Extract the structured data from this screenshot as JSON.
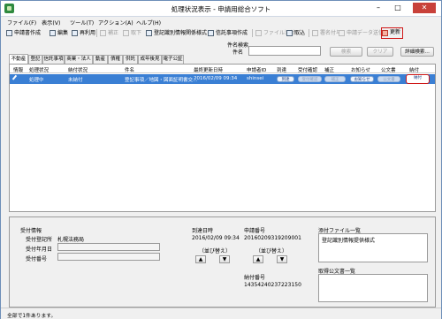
{
  "window": {
    "title": "処理状況表示 - 申請用総合ソフト",
    "controls": {
      "minimize": "–",
      "maximize": "□",
      "close": "✕"
    }
  },
  "menu": [
    "ファイル(F)",
    "表示(V)",
    "ツール(T)",
    "アクション(A)",
    "ヘルプ(H)"
  ],
  "toolbar": {
    "items": [
      {
        "label": "申請書作成",
        "icon": "new-document-icon",
        "enabled": true
      },
      {
        "label": "編集",
        "icon": "edit-icon",
        "enabled": true
      },
      {
        "label": "再利用",
        "icon": "reuse-icon",
        "enabled": true
      },
      {
        "label": "補正",
        "icon": "amend-icon",
        "enabled": false
      },
      {
        "label": "取下",
        "icon": "withdraw-icon",
        "enabled": false
      },
      {
        "label": "登記識別情報関係様式",
        "icon": "form-icon",
        "enabled": true
      },
      {
        "label": "信託事項作成",
        "icon": "trust-icon",
        "enabled": true
      },
      {
        "label": "ファイル添付",
        "icon": "attach-icon",
        "enabled": false
      },
      {
        "label": "取込",
        "icon": "import-icon",
        "enabled": true
      },
      {
        "label": "署名付与",
        "icon": "sign-icon",
        "enabled": false
      },
      {
        "label": "申請データ送信",
        "icon": "send-icon",
        "enabled": false
      },
      {
        "label": "更新",
        "icon": "refresh-icon",
        "enabled": true
      }
    ]
  },
  "search": {
    "group_label": "件名検索",
    "field_label": "件名",
    "value": "",
    "search_button": "検索",
    "clear_button": "クリア",
    "detail_button": "詳細検索..."
  },
  "tabs": [
    "不動産",
    "登記",
    "信託事項",
    "商業・法人",
    "動産",
    "債権",
    "供託",
    "成年後見",
    "電子公証"
  ],
  "grid": {
    "columns": [
      "情報",
      "処理状況",
      "納付状況",
      "件名",
      "最終更新日時",
      "申請者ID",
      "到達",
      "受付確認",
      "補正",
      "お知らせ",
      "公文書",
      "納付"
    ],
    "rows": [
      {
        "status": "処理中",
        "payment_status": "未納付",
        "subject": "登記事項／地図・図面証明書交...",
        "updated": "2016/02/09 09:34",
        "applicant_id": "shinsei",
        "actions": {
          "arrival": "到達",
          "receipt": "受付確認",
          "amend": "補正",
          "notice": "お知らせ",
          "official": "公文書",
          "payment": "納付"
        }
      }
    ]
  },
  "details": {
    "receipt_info_label": "受付情報",
    "receipt_office_label": "受付登記所",
    "receipt_office_value": "札幌法務局",
    "receipt_date_label": "受付年月日",
    "receipt_date_value": "",
    "receipt_number_label": "受付番号",
    "receipt_number_value": "",
    "arrival_label": "到達日時",
    "arrival_value": "2016/02/09 09:34",
    "sort_label": "（並び替え）",
    "application_number_label": "申請番号",
    "application_number_value": "20160209319209001",
    "sort_label2": "（並び替え）",
    "payment_number_label": "納付番号",
    "payment_number_value": "14354240237223150",
    "attached_files_label": "添付ファイル一覧",
    "attached_files_value": "登記識別情報提供様式",
    "documents_label": "取得公文書一覧",
    "documents_value": "",
    "up_arrow": "▲",
    "down_arrow": "▼"
  },
  "status": {
    "text": "全部で1件あります。"
  }
}
